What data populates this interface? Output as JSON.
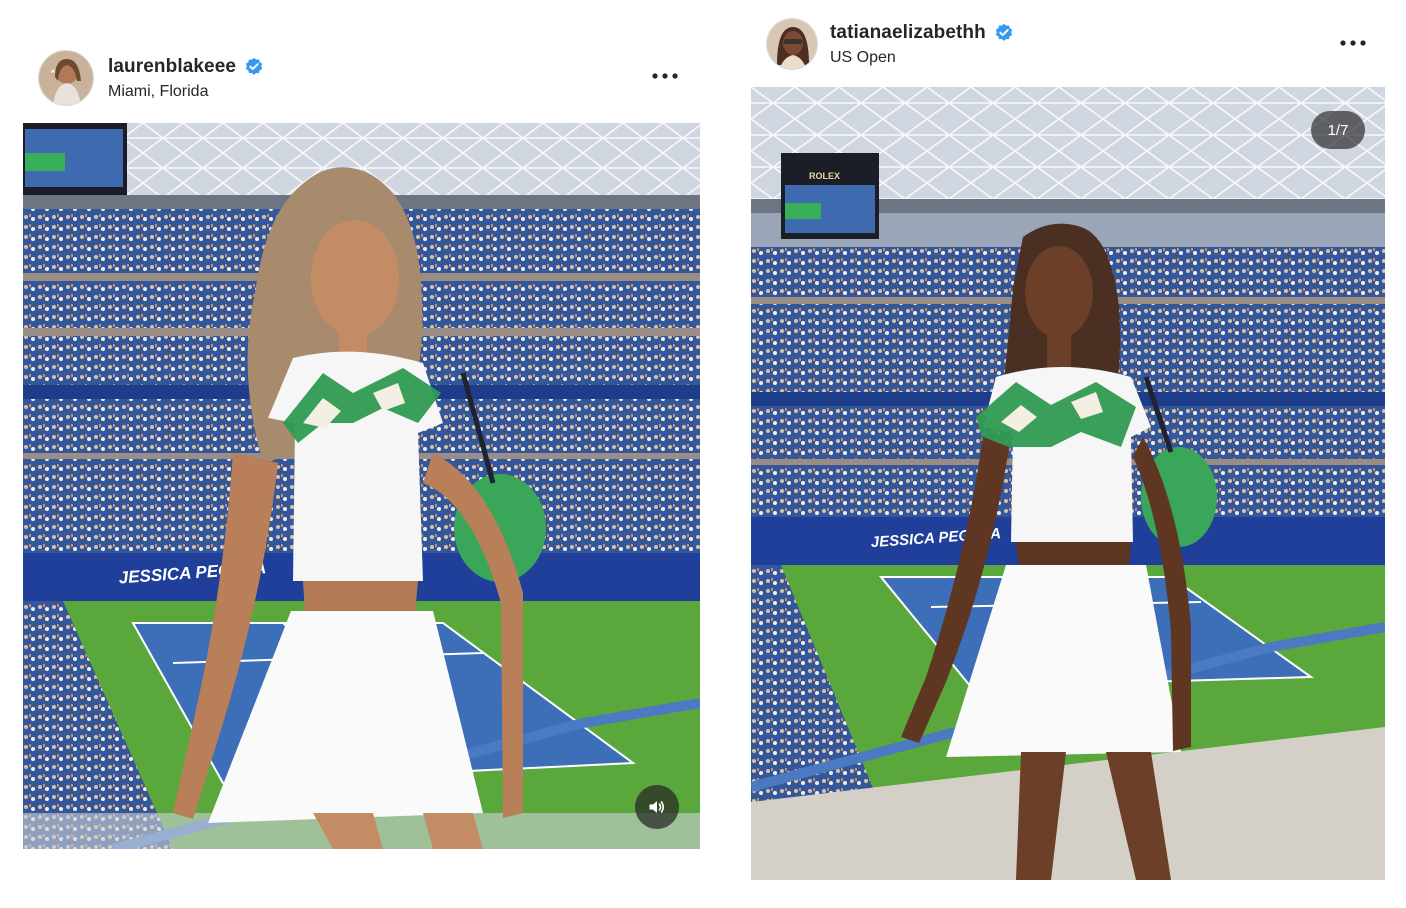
{
  "posts": [
    {
      "username": "laurenblakeee",
      "location": "Miami, Florida",
      "verified": true,
      "sound_icon": "speaker-icon",
      "scene_banner": "JESSICA PEGULA"
    },
    {
      "username": "tatianaelizabethh",
      "location": "US Open",
      "verified": true,
      "carousel_counter": "1/7",
      "scene_banner": "JESSICA PEGULA",
      "scoreboard_brand": "ROLEX"
    }
  ],
  "colors": {
    "verified_blue": "#3897f0",
    "court_green": "#5aa83c",
    "court_blue": "#3d6fb8",
    "seat_blue": "#2f4f8f",
    "banner_blue": "#1f3f9a"
  },
  "icons": [
    "more-options-icon",
    "verified-badge-icon",
    "speaker-icon"
  ]
}
